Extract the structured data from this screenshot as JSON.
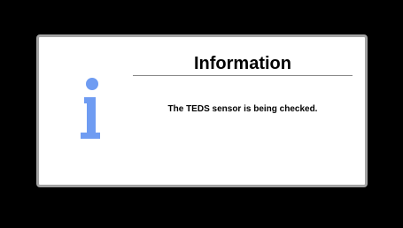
{
  "dialog": {
    "title": "Information",
    "message": "The TEDS sensor is being checked.",
    "icon": "info-icon"
  },
  "colors": {
    "background": "#000000",
    "dialog_background": "#ffffff",
    "dialog_border": "#a3a3a3",
    "icon": "#6f9cf2"
  }
}
